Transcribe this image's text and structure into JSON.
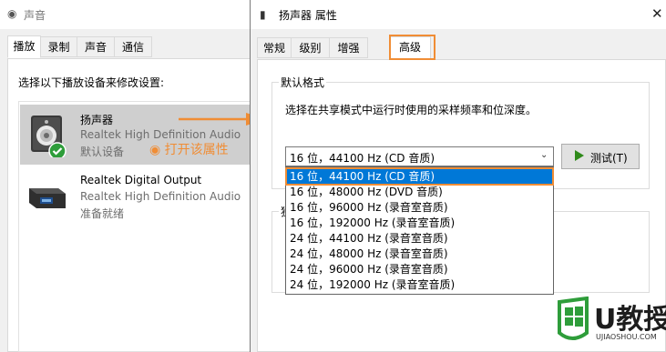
{
  "sound_window": {
    "title": "声音",
    "tabs": [
      {
        "label": "播放",
        "active": true
      },
      {
        "label": "录制",
        "active": false
      },
      {
        "label": "声音",
        "active": false
      },
      {
        "label": "通信",
        "active": false
      }
    ],
    "instruction": "选择以下播放设备来修改设置:",
    "devices": [
      {
        "name": "扬声器",
        "driver": "Realtek High Definition Audio",
        "status": "默认设备",
        "icon": "speaker-icon",
        "selected": true
      },
      {
        "name": "Realtek Digital Output",
        "driver": "Realtek High Definition Audio",
        "status": "准备就绪",
        "icon": "digital-output-icon",
        "selected": false
      }
    ]
  },
  "annotation": {
    "text": "打开该属性",
    "color": "#f08d35"
  },
  "properties_window": {
    "title": "扬声器 属性",
    "close_label": "✕",
    "tabs": [
      {
        "label": "常规",
        "active": false
      },
      {
        "label": "级别",
        "active": false
      },
      {
        "label": "增强",
        "active": false
      },
      {
        "label": "高级",
        "active": true
      }
    ],
    "default_format": {
      "group_label": "默认格式",
      "description": "选择在共享模式中运行时使用的采样频率和位深度。",
      "selected_value": "16 位，44100 Hz (CD 音质)",
      "test_button_label": "测试(T)"
    },
    "exclusive_group_label": "独",
    "format_options": [
      "16 位，44100 Hz (CD 音质)",
      "16 位，48000 Hz (DVD 音质)",
      "16 位，96000 Hz (录音室音质)",
      "16 位，192000 Hz (录音室音质)",
      "24 位，44100 Hz (录音室音质)",
      "24 位，48000 Hz (录音室音质)",
      "24 位，96000 Hz (录音室音质)",
      "24 位，192000 Hz (录音室音质)"
    ]
  },
  "watermark": {
    "brand": "U教授",
    "url": "UJIAOSHOU.COM"
  },
  "colors": {
    "accent": "#f08d35",
    "selection": "#0078d7",
    "brand_green": "#2e9d3a"
  }
}
